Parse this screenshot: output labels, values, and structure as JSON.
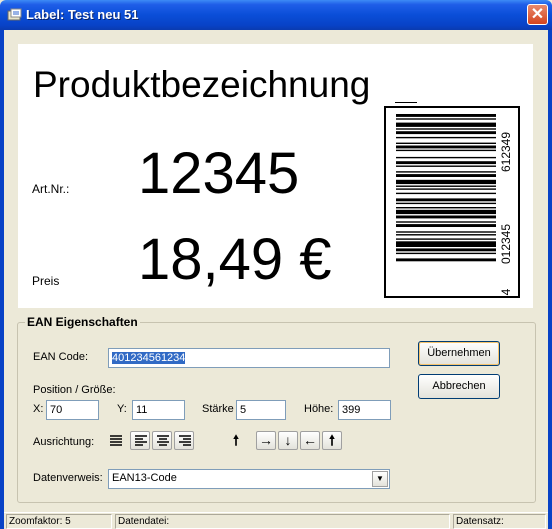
{
  "window": {
    "title": "Label: Test neu 51",
    "close_glyph": "✕"
  },
  "label": {
    "product_name": "Produktbezeichnung",
    "artnr_label": "Art.Nr.:",
    "artnr_value": "12345",
    "price_label": "Preis",
    "price_value": "18,49 €",
    "barcode_text_1": "4",
    "barcode_text_2": "012345",
    "barcode_text_3": "612349"
  },
  "ean": {
    "group_title": "EAN Eigenschaften",
    "code_label": "EAN Code:",
    "code_value": "40123456​1234",
    "position_label": "Position / Größe:",
    "x_label": "X:",
    "x_value": "70",
    "y_label": "Y:",
    "y_value": "11",
    "staerke_label": "Stärke",
    "staerke_value": "5",
    "hoehe_label": "Höhe:",
    "hoehe_value": "399",
    "alignment_label": "Ausrichtung:",
    "datenverweis_label": "Datenverweis:",
    "datenverweis_value": "EAN13-Code",
    "apply_button": "Übernehmen",
    "cancel_button": "Abbrechen",
    "alignment_icons": [
      "align-justify-icon",
      "align-left-icon",
      "align-center-icon",
      "align-right-icon"
    ],
    "rotation_icons": [
      "arrow-up-icon",
      "arrow-right-icon",
      "arrow-down-icon",
      "arrow-left-icon",
      "arrow-up-icon"
    ],
    "rotation_glyphs": [
      "🠕",
      "→",
      "↓",
      "←",
      "🠕"
    ]
  },
  "status": {
    "zoom": "Zoomfaktor: 5",
    "datafile": "Datendatei:",
    "record": "Datensatz:"
  },
  "colors": {
    "titlebar": "#0a4ed8",
    "selection": "#316ac5",
    "close": "#d5441e"
  }
}
